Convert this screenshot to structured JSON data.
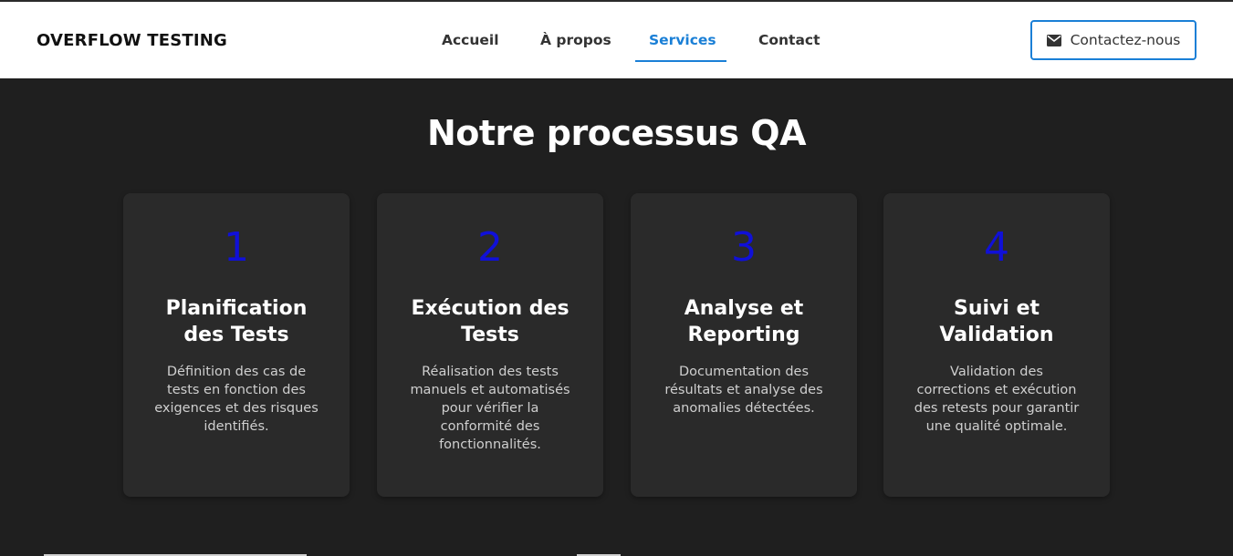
{
  "header": {
    "brand": "OVERFLOW TESTING",
    "nav": [
      {
        "label": "Accueil",
        "active": false
      },
      {
        "label": "À propos",
        "active": false
      },
      {
        "label": "Services",
        "active": true
      },
      {
        "label": "Contact",
        "active": false
      }
    ],
    "cta_label": "Contactez-nous",
    "cta_icon": "envelope-icon",
    "accent_color": "#1a7fd6"
  },
  "main": {
    "heading": "Notre processus QA",
    "number_color": "#1010d8",
    "steps": [
      {
        "number": "1",
        "title": "Planification des Tests",
        "description": "Définition des cas de tests en fonction des exigences et des risques identifiés."
      },
      {
        "number": "2",
        "title": "Exécution des Tests",
        "description": "Réalisation des tests manuels et automatisés pour vérifier la conformité des fonctionnalités."
      },
      {
        "number": "3",
        "title": "Analyse et Reporting",
        "description": "Documentation des résultats et analyse des anomalies détectées."
      },
      {
        "number": "4",
        "title": "Suivi et Validation",
        "description": "Validation des corrections et exécution des retests pour garantir une qualité optimale."
      }
    ]
  }
}
